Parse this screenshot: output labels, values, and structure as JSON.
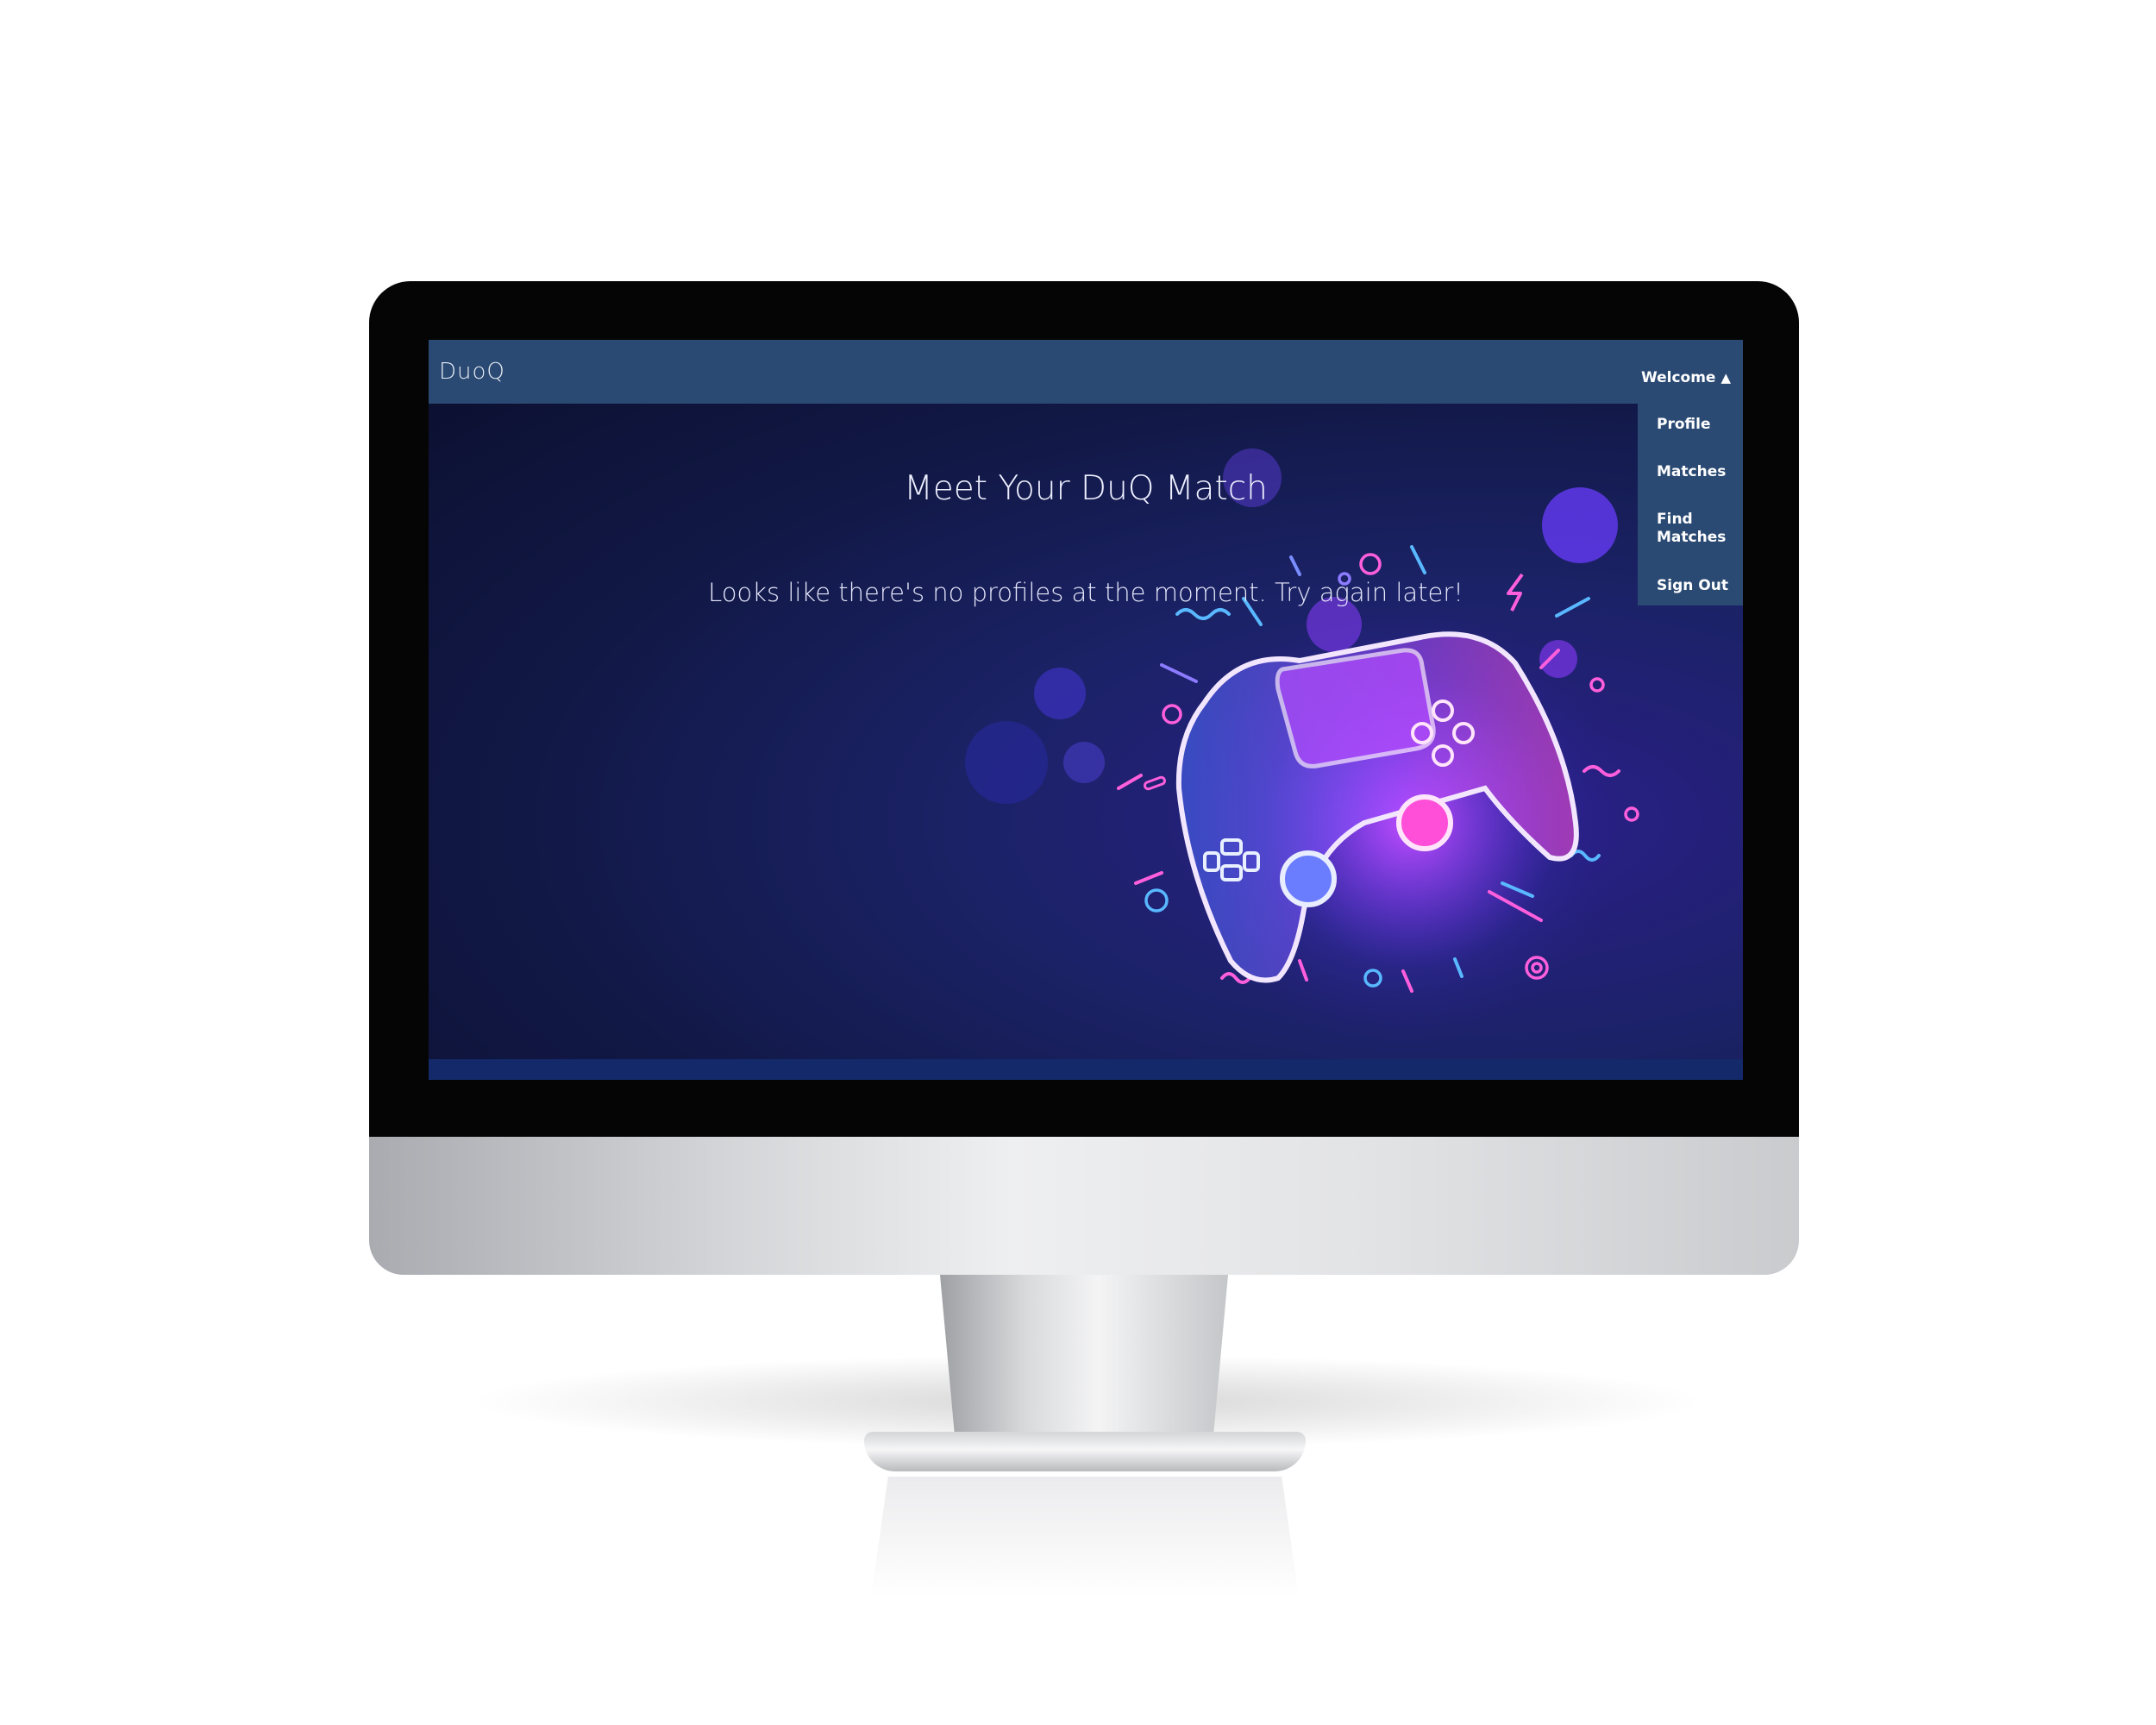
{
  "navbar": {
    "brand": "DuoQ",
    "welcome_label": "Welcome",
    "welcome_caret": "▲"
  },
  "dropdown": {
    "items": [
      {
        "label": "Profile"
      },
      {
        "label": "Matches"
      },
      {
        "label": "Find Matches"
      },
      {
        "label": "Sign Out"
      }
    ]
  },
  "main": {
    "title": "Meet Your DuQ Match",
    "message": "Looks like there's no profiles at the moment. Try again later!"
  },
  "colors": {
    "navbar": "#2b4a73",
    "background": "#111845",
    "neon_pink": "#ff4fd8",
    "neon_blue": "#59b8ff",
    "neon_purple": "#9b4dff"
  },
  "icons": {
    "hero_art": "game-controller-illustration"
  }
}
